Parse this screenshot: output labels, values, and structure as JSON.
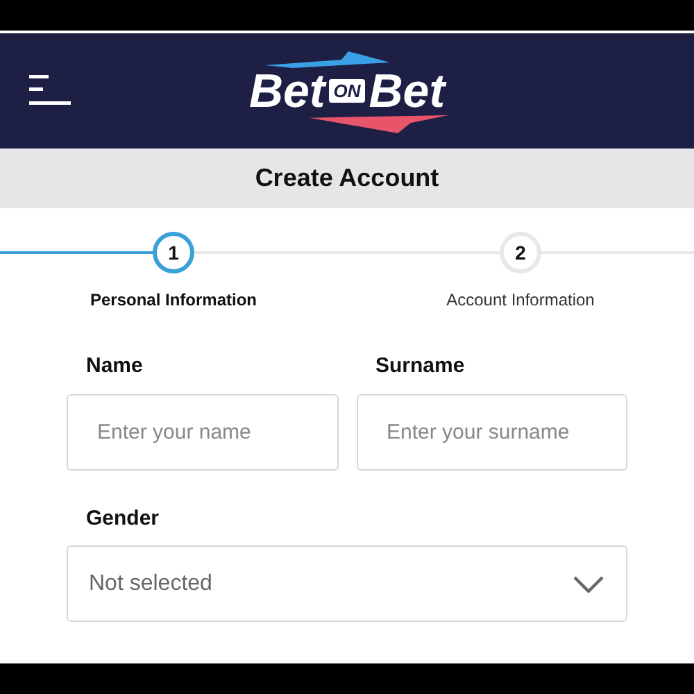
{
  "logo": {
    "left": "Bet",
    "badge": "ON",
    "right": "Bet"
  },
  "page_title": "Create Account",
  "steps": [
    {
      "number": "1",
      "label": "Personal Information",
      "selected": true
    },
    {
      "number": "2",
      "label": "Account Information",
      "selected": false
    }
  ],
  "fields": [
    {
      "label": "Name",
      "placeholder": "Enter your name"
    },
    {
      "label": "Surname",
      "placeholder": "Enter your surname"
    }
  ],
  "gender": {
    "label": "Gender",
    "value": "Not selected"
  }
}
